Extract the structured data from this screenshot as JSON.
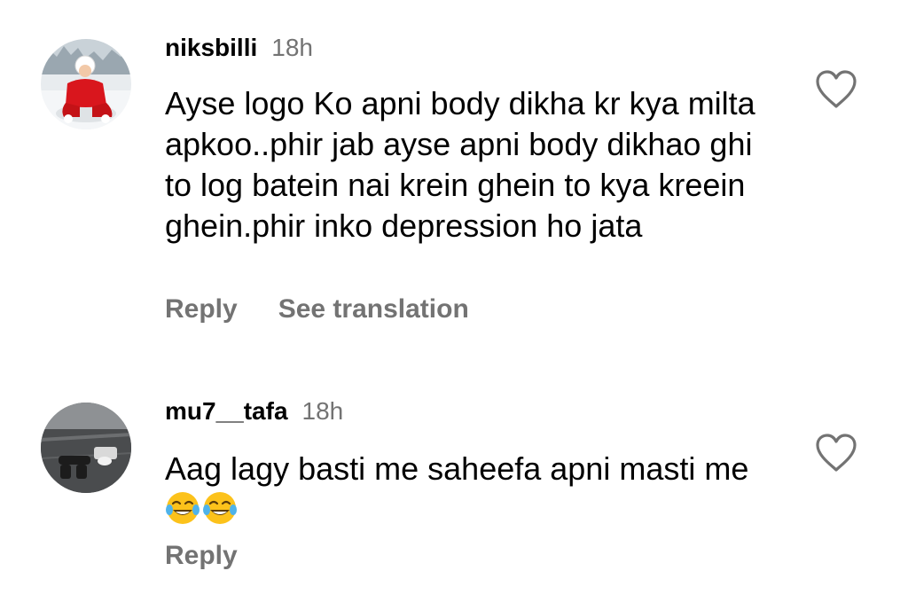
{
  "comments": [
    {
      "username": "niksbilli",
      "time": "18h",
      "text": "Ayse logo Ko apni body dikha kr kya milta apkoo..phir jab ayse apni body dikhao ghi to log batein nai krein ghein to kya kreein ghein.phir inko depression ho jata",
      "actions": {
        "reply": "Reply",
        "translate": "See translation"
      },
      "avatar_icon": "child-in-red-snowsuit-avatar",
      "like_icon": "heart-outline-icon"
    },
    {
      "username": "mu7__tafa",
      "time": "18h",
      "text": "Aag lagy basti me saheefa apni masti me",
      "emojis": [
        "😂",
        "😂"
      ],
      "actions": {
        "reply": "Reply"
      },
      "avatar_icon": "person-lying-on-ground-avatar",
      "like_icon": "heart-outline-icon"
    }
  ],
  "colors": {
    "primary_text": "#000000",
    "secondary_text": "#737373",
    "background": "#ffffff"
  }
}
